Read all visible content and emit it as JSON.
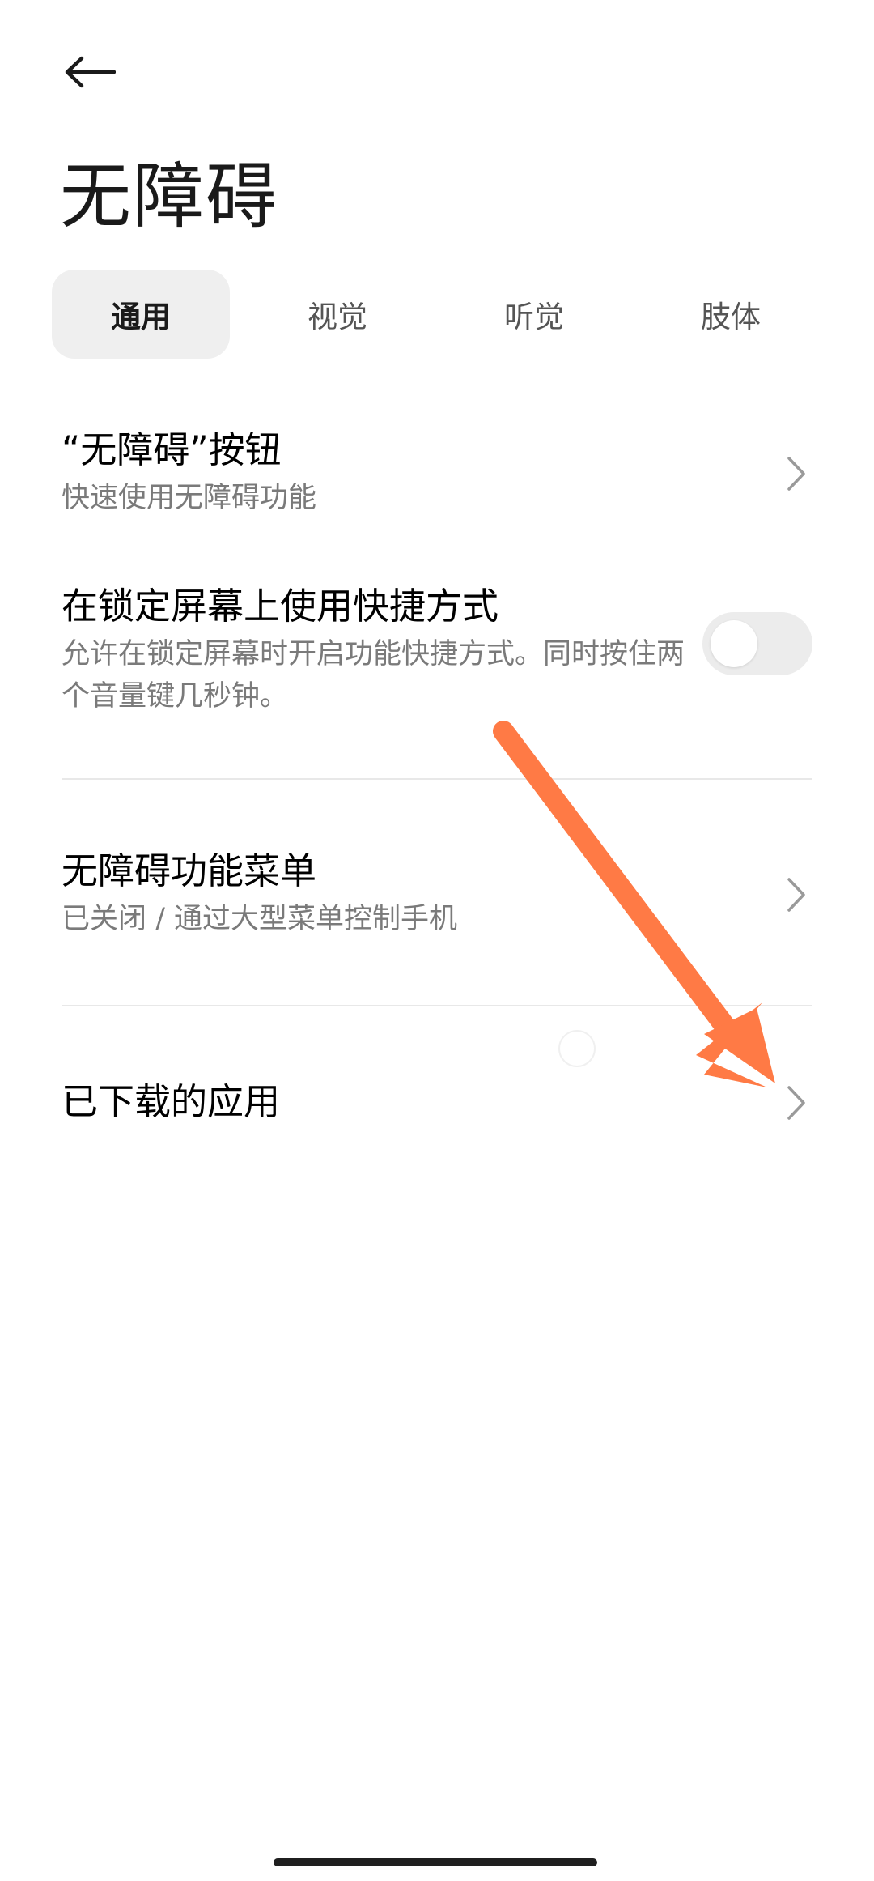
{
  "header": {
    "back_icon": "arrow-left-icon",
    "title": "无障碍"
  },
  "tabs": [
    {
      "label": "通用",
      "active": true
    },
    {
      "label": "视觉",
      "active": false
    },
    {
      "label": "听觉",
      "active": false
    },
    {
      "label": "肢体",
      "active": false
    }
  ],
  "settings": {
    "accessibility_button": {
      "title": "“无障碍”按钮",
      "subtitle": "快速使用无障碍功能"
    },
    "lockscreen_shortcut": {
      "title": "在锁定屏幕上使用快捷方式",
      "subtitle": "允许在锁定屏幕时开启功能快捷方式。同时按住两个音量键几秒钟。",
      "toggle_on": false
    },
    "accessibility_menu": {
      "title": "无障碍功能菜单",
      "subtitle": "已关闭 / 通过大型菜单控制手机"
    },
    "downloaded_apps": {
      "title": "已下载的应用"
    }
  },
  "colors": {
    "annotation_arrow": "#FF7A45",
    "active_tab_bg": "#EFEFEF",
    "toggle_off_bg": "#ECECEC"
  }
}
